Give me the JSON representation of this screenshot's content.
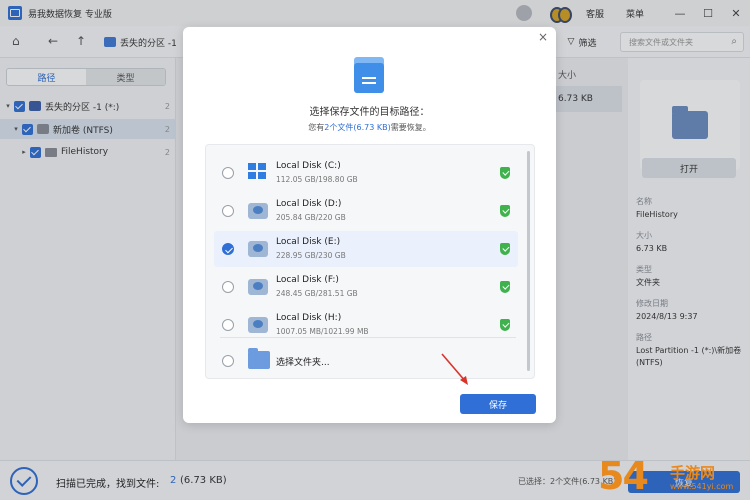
{
  "app": {
    "title": "易我数据恢复 专业版"
  },
  "titlebar": {
    "service": "客服",
    "menu": "菜单",
    "minimize": "—",
    "maximize": "☐",
    "close": "✕"
  },
  "toolbar": {
    "path": "丢失的分区 -1",
    "filter": "筛选",
    "search_placeholder": "搜索文件或文件夹"
  },
  "left_panel": {
    "tabs": [
      "路径",
      "类型"
    ],
    "tree": [
      {
        "label": "丢失的分区 -1 (*:)",
        "count": "2"
      },
      {
        "label": "新加卷 (NTFS)",
        "count": "2"
      },
      {
        "label": "FileHistory",
        "count": "2"
      }
    ]
  },
  "list": {
    "size_header": "大小",
    "size_value": "6.73 KB"
  },
  "info": {
    "open_button": "打开",
    "fields": [
      {
        "label": "名称",
        "value": "FileHistory"
      },
      {
        "label": "大小",
        "value": "6.73 KB"
      },
      {
        "label": "类型",
        "value": "文件夹"
      },
      {
        "label": "修改日期",
        "value": "2024/8/13 9:37"
      },
      {
        "label": "路径",
        "value": "Lost Partition -1 (*:)\\新加卷 (NTFS)"
      }
    ]
  },
  "modal": {
    "close": "×",
    "title": "选择保存文件的目标路径：",
    "sub_prefix": "您有",
    "sub_highlight": "2个文件(6.73 KB)",
    "sub_suffix": "需要恢复。",
    "drives": [
      {
        "name": "Local Disk (C:)",
        "size": "112.05 GB/198.80 GB",
        "selected": false
      },
      {
        "name": "Local Disk (D:)",
        "size": "205.84 GB/220 GB",
        "selected": false
      },
      {
        "name": "Local Disk (E:)",
        "size": "228.95 GB/230 GB",
        "selected": true
      },
      {
        "name": "Local Disk (F:)",
        "size": "248.45 GB/281.51 GB",
        "selected": false
      },
      {
        "name": "Local Disk (H:)",
        "size": "1007.05 MB/1021.99 MB",
        "selected": false
      }
    ],
    "choose_folder": "选择文件夹...",
    "save_button": "保存",
    "accent_color": "#2f6fd6"
  },
  "status": {
    "text": "扫描已完成，找到文件:",
    "count": "2",
    "size": "(6.73 KB)",
    "selected": "已选择：2个文件(6.73 KB)",
    "recover_button": "恢复"
  },
  "watermark": {
    "digits": "54",
    "text": "手游网",
    "url": "www.541yi.com"
  }
}
